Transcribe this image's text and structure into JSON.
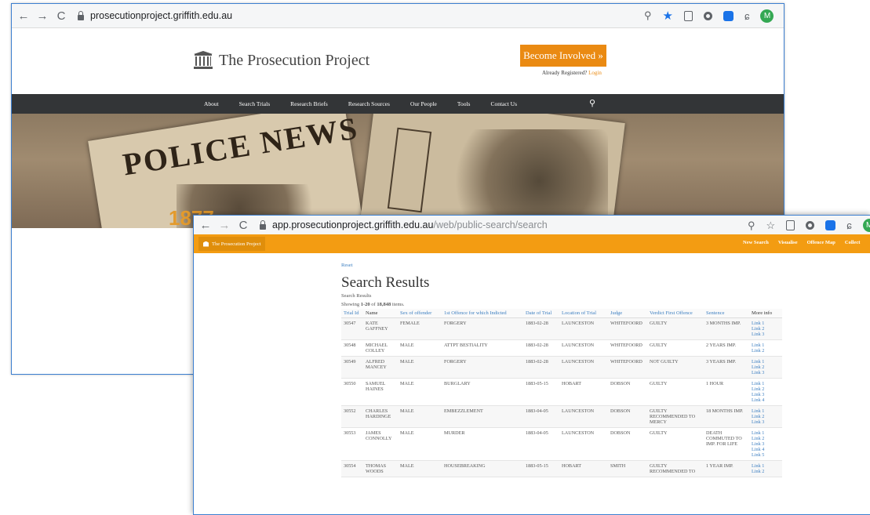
{
  "window1": {
    "url": "prosecutionproject.griffith.edu.au",
    "site_title": "The Prosecution Project",
    "become_button": "Become Involved »",
    "already_registered": "Already Registered?",
    "login_link": "Login",
    "nav": [
      "About",
      "Search Trials",
      "Research Briefs",
      "Research Sources",
      "Our People",
      "Tools",
      "Contact Us"
    ],
    "hero_masthead": "POLICE NEWS",
    "hero_year": "1877",
    "profile_initial": "M"
  },
  "window2": {
    "url_host": "app.prosecutionproject.griffith.edu.au",
    "url_path": "/web/public-search/search",
    "brand": "The Prosecution Project",
    "menu": [
      "New Search",
      "Visualise",
      "Offence Map",
      "Collect"
    ],
    "profile_initial": "M",
    "reset": "Reset",
    "title": "Search Results",
    "subtitle": "Search Results",
    "showing_prefix": "Showing ",
    "showing_range": "1-20",
    "showing_of": " of ",
    "showing_total": "18,848",
    "showing_suffix": " items.",
    "columns": [
      "Trial Id",
      "Name",
      "Sex of offender",
      "1st Offence for which Indicted",
      "Date of Trial",
      "Location of Trial",
      "Judge",
      "Verdict First Offence",
      "Sentence",
      "More info"
    ],
    "rows": [
      {
        "id": "30547",
        "name": "KATE GAFFNEY",
        "sex": "FEMALE",
        "offence": "FORGERY",
        "date": "1883-02-28",
        "location": "LAUNCESTON",
        "judge": "WHITEFOORD",
        "verdict": "GUILTY",
        "sentence": "3 MONTHS IMP.",
        "links": [
          "Link 1",
          "Link 2",
          "Link 3"
        ]
      },
      {
        "id": "30548",
        "name": "MICHAEL COLLEY",
        "sex": "MALE",
        "offence": "ATTPT BESTIALITY",
        "date": "1883-02-28",
        "location": "LAUNCESTON",
        "judge": "WHITEFOORD",
        "verdict": "GUILTY",
        "sentence": "2 YEARS IMP.",
        "links": [
          "Link 1",
          "Link 2"
        ]
      },
      {
        "id": "30549",
        "name": "ALFRED MANCEY",
        "sex": "MALE",
        "offence": "FORGERY",
        "date": "1883-02-28",
        "location": "LAUNCESTON",
        "judge": "WHITEFOORD",
        "verdict": "NOT GUILTY",
        "sentence": "3 YEARS IMP.",
        "links": [
          "Link 1",
          "Link 2",
          "Link 3"
        ]
      },
      {
        "id": "30550",
        "name": "SAMUEL HAINES",
        "sex": "MALE",
        "offence": "BURGLARY",
        "date": "1883-05-15",
        "location": "HOBART",
        "judge": "DOBSON",
        "verdict": "GUILTY",
        "sentence": "1 HOUR",
        "links": [
          "Link 1",
          "Link 2",
          "Link 3",
          "Link 4"
        ]
      },
      {
        "id": "30552",
        "name": "CHARLES HARDINGE",
        "sex": "MALE",
        "offence": "EMBEZZLEMENT",
        "date": "1883-04-05",
        "location": "LAUNCESTON",
        "judge": "DOBSON",
        "verdict": "GUILTY RECOMMENDED TO MERCY",
        "sentence": "18 MONTHS IMP.",
        "links": [
          "Link 1",
          "Link 2",
          "Link 3"
        ]
      },
      {
        "id": "30553",
        "name": "JAMES CONNOLLY",
        "sex": "MALE",
        "offence": "MURDER",
        "date": "1883-04-05",
        "location": "LAUNCESTON",
        "judge": "DOBSON",
        "verdict": "GUILTY",
        "sentence": "DEATH COMMUTED TO IMP. FOR LIFE",
        "links": [
          "Link 1",
          "Link 2",
          "Link 3",
          "Link 4",
          "Link 5"
        ]
      },
      {
        "id": "30554",
        "name": "THOMAS WOODS",
        "sex": "MALE",
        "offence": "HOUSEBREAKING",
        "date": "1883-05-15",
        "location": "HOBART",
        "judge": "SMITH",
        "verdict": "GUILTY RECOMMENDED TO",
        "sentence": "1 YEAR IMP.",
        "links": [
          "Link 1",
          "Link 2"
        ]
      }
    ]
  },
  "colors": {
    "orange": "#f39c12",
    "nav_dark": "#333537",
    "link_blue": "#3d7fc1",
    "window_border": "#3c7fd0"
  }
}
